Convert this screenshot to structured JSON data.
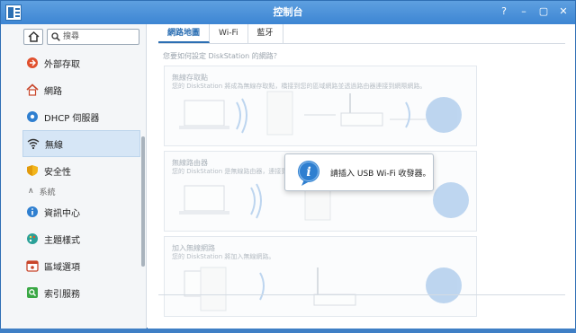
{
  "window": {
    "title": "控制台",
    "controls": [
      "?",
      "–",
      "▢",
      "✕"
    ]
  },
  "sidebar": {
    "search_placeholder": "搜尋",
    "items": [
      {
        "label": "外部存取",
        "icon": "external-access-icon"
      },
      {
        "label": "網路",
        "icon": "network-house-icon"
      },
      {
        "label": "DHCP 伺服器",
        "icon": "dhcp-server-icon"
      },
      {
        "label": "無線",
        "icon": "wireless-icon",
        "active": true
      },
      {
        "label": "安全性",
        "icon": "security-shield-icon"
      }
    ],
    "section": {
      "label": "系統"
    },
    "system_items": [
      {
        "label": "資訊中心",
        "icon": "info-center-icon"
      },
      {
        "label": "主題樣式",
        "icon": "theme-palette-icon"
      },
      {
        "label": "區域選項",
        "icon": "regional-calendar-icon"
      },
      {
        "label": "索引服務",
        "icon": "index-service-icon"
      }
    ]
  },
  "main": {
    "tabs": [
      {
        "label": "網路地圖",
        "active": true
      },
      {
        "label": "Wi-Fi"
      },
      {
        "label": "藍牙"
      }
    ],
    "question": "您要如何設定 DiskStation 的網路？",
    "cards": [
      {
        "title": "無線存取點",
        "desc": "您的 DiskStation 將成為無線存取點，橋接到您的區域網路並透過路由器連接到網際網路。"
      },
      {
        "title": "無線路由器",
        "desc": "您的 DiskStation 是無線路由器，連接到 ..."
      },
      {
        "title": "加入無線網路",
        "desc": "您的 DiskStation 將加入無線網路。"
      }
    ]
  },
  "toast": {
    "message": "請插入 USB Wi-Fi 收發器。",
    "icon": "info-icon"
  },
  "colors": {
    "titlebar": "#3d86d3",
    "accent": "#2c6fb3",
    "active_item": "#d6e6f6"
  }
}
